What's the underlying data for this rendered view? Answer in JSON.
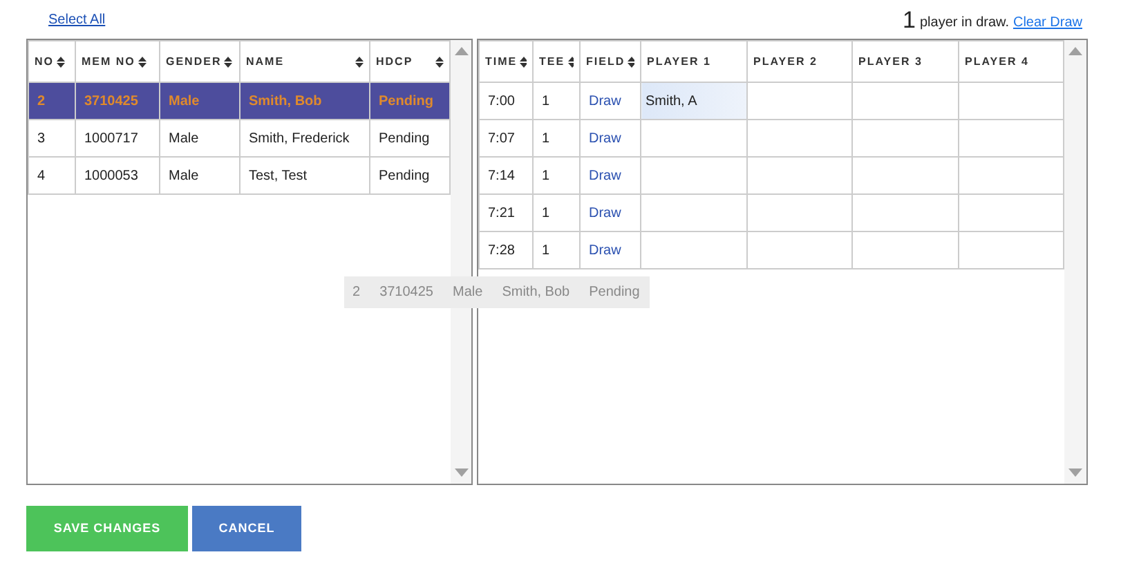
{
  "select_all": "Select All",
  "draw_summary": {
    "count": "1",
    "text": "player in draw.",
    "link": "Clear Draw"
  },
  "members": {
    "columns": [
      {
        "label": "NO",
        "sortable": true
      },
      {
        "label": "MEM NO",
        "sortable": true
      },
      {
        "label": "GENDER",
        "sortable": true
      },
      {
        "label": "NAME",
        "sortable": true
      },
      {
        "label": "HDCP",
        "sortable": true
      }
    ],
    "rows": [
      {
        "cells": [
          "2",
          "3710425",
          "Male",
          "Smith, Bob",
          "Pending"
        ],
        "selected": true
      },
      {
        "cells": [
          "3",
          "1000717",
          "Male",
          "Smith, Frederick",
          "Pending"
        ],
        "selected": false
      },
      {
        "cells": [
          "4",
          "1000053",
          "Male",
          "Test, Test",
          "Pending"
        ],
        "selected": false
      }
    ]
  },
  "drag_preview": {
    "cells": [
      "2",
      "3710425",
      "Male",
      "Smith, Bob",
      "Pending"
    ]
  },
  "tee_sheet": {
    "columns": [
      {
        "label": "TIME",
        "sortable": true
      },
      {
        "label": "TEE",
        "sortable": true
      },
      {
        "label": "FIELD",
        "sortable": true
      },
      {
        "label": "PLAYER 1",
        "sortable": false
      },
      {
        "label": "PLAYER 2",
        "sortable": false
      },
      {
        "label": "PLAYER 3",
        "sortable": false
      },
      {
        "label": "PLAYER 4",
        "sortable": false
      }
    ],
    "rows": [
      {
        "time": "7:00",
        "tee": "1",
        "field": "Draw",
        "players": [
          {
            "name": "Smith, A",
            "highlighted": true
          }
        ]
      },
      {
        "time": "7:07",
        "tee": "1",
        "field": "Draw"
      },
      {
        "time": "7:14",
        "tee": "1",
        "field": "Draw"
      },
      {
        "time": "7:21",
        "tee": "1",
        "field": "Draw"
      },
      {
        "time": "7:28",
        "tee": "1",
        "field": "Draw"
      }
    ]
  },
  "buttons": [
    {
      "label": "SAVE CHANGES",
      "kind": "primary"
    },
    {
      "label": "CANCEL",
      "kind": "secondary"
    }
  ]
}
